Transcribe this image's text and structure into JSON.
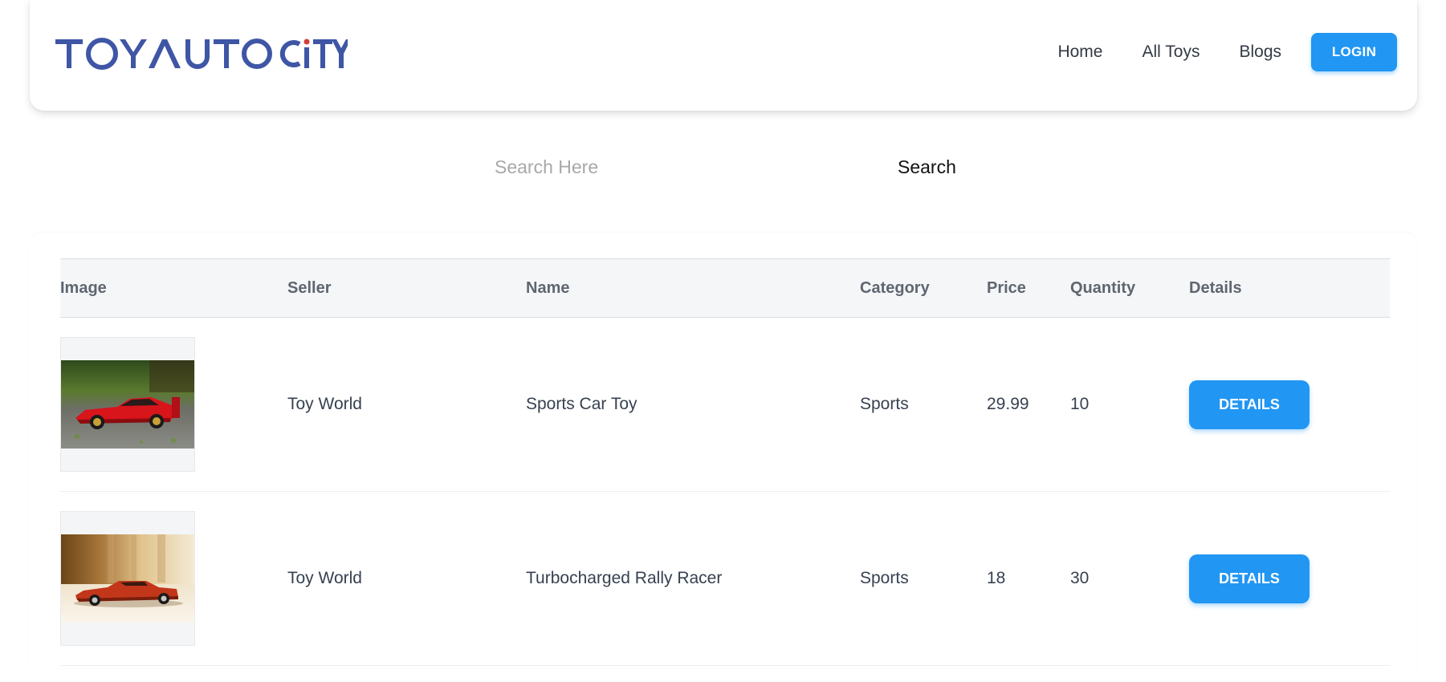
{
  "brand": {
    "logo_text": "TOYAUTO CITY",
    "color": "#3f56a6"
  },
  "nav": {
    "links": [
      "Home",
      "All Toys",
      "Blogs"
    ],
    "login_label": "LOGIN"
  },
  "search": {
    "placeholder": "Search Here",
    "value": "",
    "button_label": "Search"
  },
  "table": {
    "headers": {
      "image": "Image",
      "seller": "Seller",
      "name": "Name",
      "category": "Category",
      "price": "Price",
      "quantity": "Quantity",
      "details": "Details"
    },
    "rows": [
      {
        "image_icon": "red-sports-car-photo",
        "seller": "Toy World",
        "name": "Sports Car Toy",
        "category": "Sports",
        "price": "29.99",
        "quantity": "10",
        "details_label": "DETAILS"
      },
      {
        "image_icon": "orange-rally-car-photo",
        "seller": "Toy World",
        "name": "Turbocharged Rally Racer",
        "category": "Sports",
        "price": "18",
        "quantity": "30",
        "details_label": "DETAILS"
      }
    ]
  },
  "colors": {
    "accent": "#2196f3",
    "header_bg": "#f4f6f8"
  }
}
